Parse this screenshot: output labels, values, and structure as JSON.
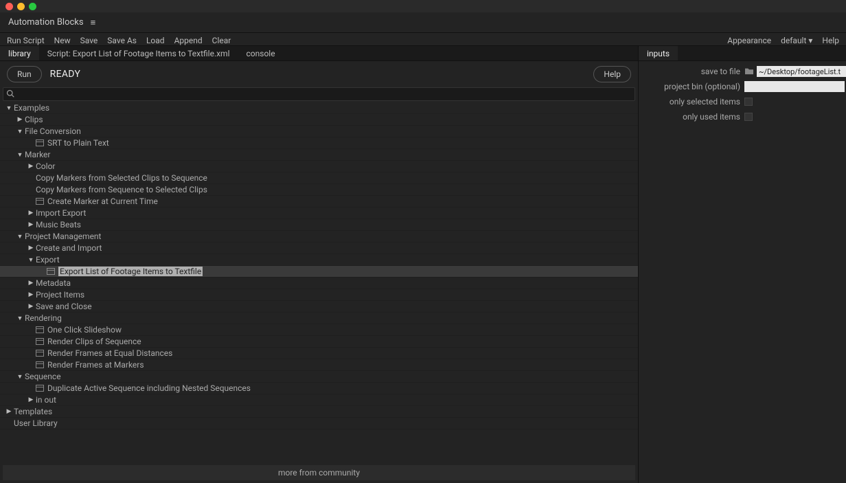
{
  "panelTitle": "Automation Blocks",
  "menubar": {
    "items": [
      "Run Script",
      "New",
      "Save",
      "Save As",
      "Load",
      "Append",
      "Clear"
    ],
    "right": {
      "appearance": "Appearance",
      "preset": "default",
      "help": "Help"
    }
  },
  "leftTabs": {
    "library": "library",
    "script": "Script: Export List of Footage Items to Textfile.xml",
    "console": "console"
  },
  "runbar": {
    "run": "Run",
    "status": "READY",
    "help": "Help"
  },
  "search": {
    "placeholder": ""
  },
  "tree": [
    {
      "indent": 0,
      "arrow": "▼",
      "label": "Examples"
    },
    {
      "indent": 1,
      "arrow": "▶",
      "label": "Clips"
    },
    {
      "indent": 1,
      "arrow": "▼",
      "label": "File Conversion"
    },
    {
      "indent": 2,
      "icon": true,
      "label": "SRT to Plain Text"
    },
    {
      "indent": 1,
      "arrow": "▼",
      "label": "Marker"
    },
    {
      "indent": 2,
      "arrow": "▶",
      "label": "Color"
    },
    {
      "indent": 2,
      "label": "Copy Markers from Selected Clips to Sequence"
    },
    {
      "indent": 2,
      "label": "Copy Markers from Sequence to Selected Clips"
    },
    {
      "indent": 2,
      "icon": true,
      "label": "Create Marker at Current Time"
    },
    {
      "indent": 2,
      "arrow": "▶",
      "label": "Import Export"
    },
    {
      "indent": 2,
      "arrow": "▶",
      "label": "Music Beats"
    },
    {
      "indent": 1,
      "arrow": "▼",
      "label": "Project Management"
    },
    {
      "indent": 2,
      "arrow": "▶",
      "label": "Create and Import"
    },
    {
      "indent": 2,
      "arrow": "▼",
      "label": "Export"
    },
    {
      "indent": 3,
      "icon": true,
      "label": "Export List of Footage Items to Textfile",
      "selected": true
    },
    {
      "indent": 2,
      "arrow": "▶",
      "label": "Metadata"
    },
    {
      "indent": 2,
      "arrow": "▶",
      "label": "Project Items"
    },
    {
      "indent": 2,
      "arrow": "▶",
      "label": "Save and Close"
    },
    {
      "indent": 1,
      "arrow": "▼",
      "label": "Rendering"
    },
    {
      "indent": 2,
      "icon": true,
      "label": "One Click Slideshow"
    },
    {
      "indent": 2,
      "icon": true,
      "label": "Render Clips of Sequence"
    },
    {
      "indent": 2,
      "icon": true,
      "label": "Render Frames at Equal Distances"
    },
    {
      "indent": 2,
      "icon": true,
      "label": "Render Frames at Markers"
    },
    {
      "indent": 1,
      "arrow": "▼",
      "label": "Sequence"
    },
    {
      "indent": 2,
      "icon": true,
      "label": "Duplicate Active Sequence including Nested Sequences"
    },
    {
      "indent": 2,
      "arrow": "▶",
      "label": "in out"
    },
    {
      "indent": 0,
      "arrow": "▶",
      "label": "Templates"
    },
    {
      "indent": 0,
      "label": "User Library"
    }
  ],
  "moreLink": "more from community",
  "rightTab": "inputs",
  "inputs": {
    "saveToFile": {
      "label": "save to file",
      "value": "~/Desktop/footageList.t"
    },
    "projectBin": {
      "label": "project bin (optional)",
      "value": ""
    },
    "onlySelected": {
      "label": "only selected items"
    },
    "onlyUsed": {
      "label": "only used items"
    }
  }
}
